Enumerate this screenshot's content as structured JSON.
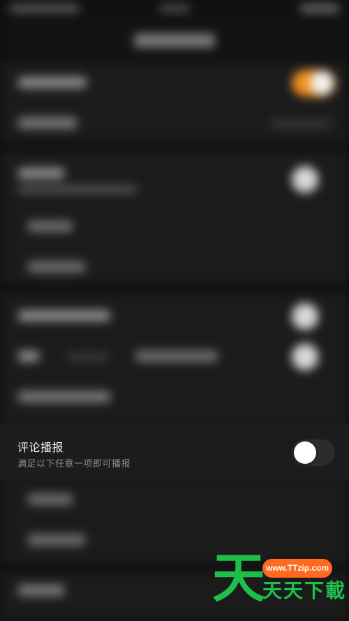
{
  "focus_setting": {
    "title": "评论播报",
    "subtitle": "满足以下任意一项即可播报",
    "toggle_on": false
  },
  "watermark": {
    "big_char": "天",
    "url": "www.TTzip.com",
    "text": "天天下載",
    "color": "#1fbf4c",
    "badge_color": "#ff6a1e"
  },
  "colors": {
    "background": "#171717",
    "row_background": "#1c1c1e",
    "toggle_off_track": "#2c2c2e",
    "toggle_on_accent": "#f0901f"
  }
}
